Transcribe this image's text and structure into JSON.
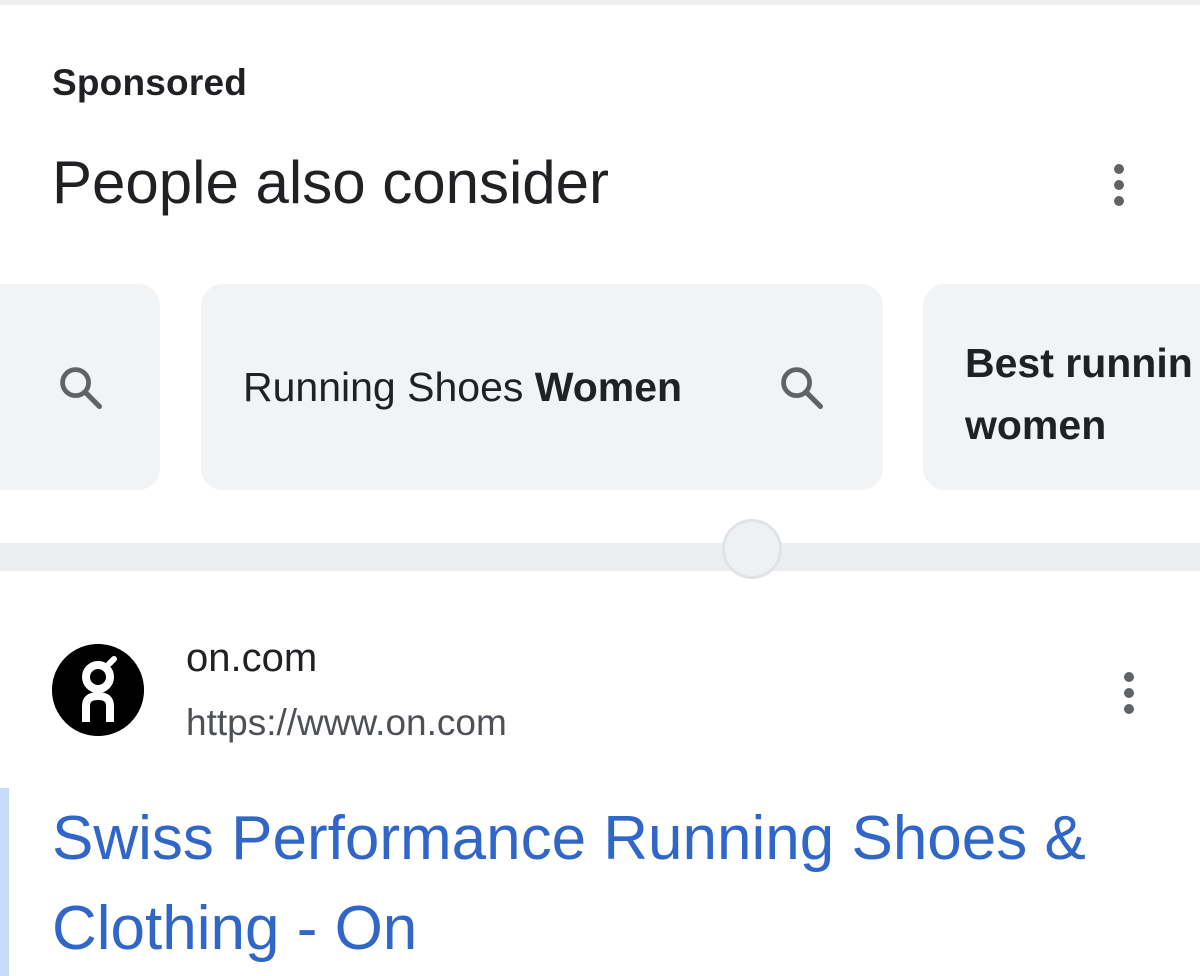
{
  "header": {
    "sponsored_label": "Sponsored",
    "title": "People also consider",
    "menu_icon": "more-vert-icon"
  },
  "chips": [
    {
      "text": "",
      "icon": "search-icon"
    },
    {
      "text_regular": "Running Shoes ",
      "text_bold": "Women",
      "icon": "search-icon"
    },
    {
      "text": "Best runnin women",
      "text_visible_line1": "Best runnin",
      "text_visible_line2": "women"
    }
  ],
  "ad": {
    "site_name": "on.com",
    "url": "https://www.on.com",
    "favicon_icon": "on-logo-icon",
    "menu_icon": "more-vert-icon",
    "title": "Swiss Performance Running Shoes & Clothing - On",
    "title_color": "#2f66c8"
  },
  "colors": {
    "chip_background": "#f1f3f4",
    "text_primary": "#202124",
    "text_secondary": "#4d5156",
    "link": "#2f66c8"
  }
}
